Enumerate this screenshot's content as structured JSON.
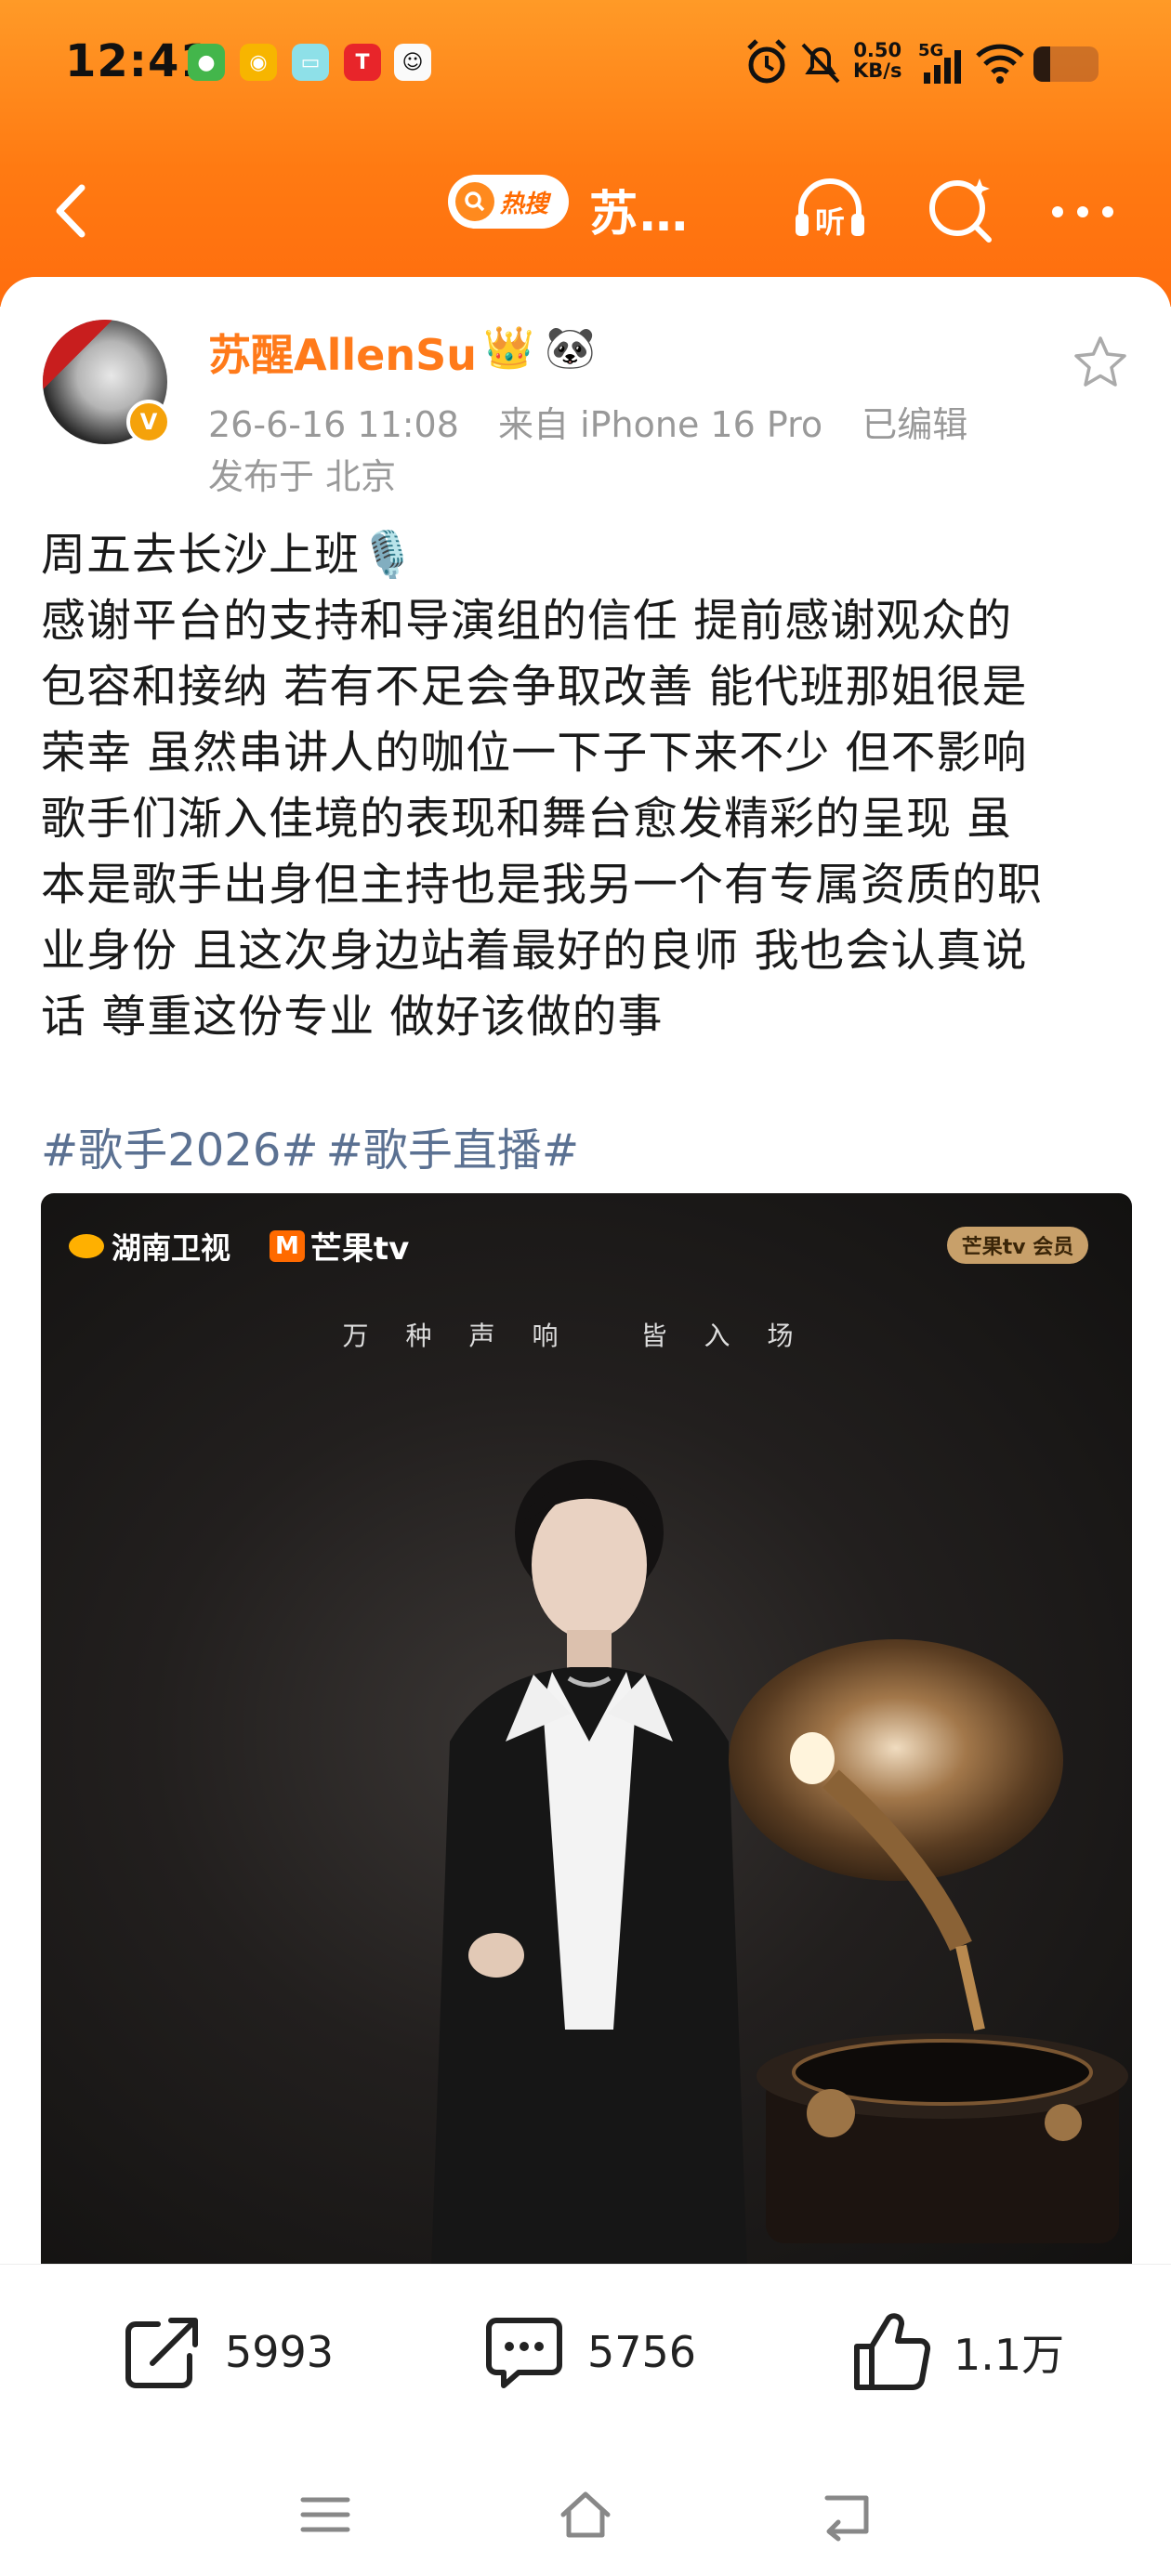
{
  "status_bar": {
    "time": "12:41",
    "net_speed_value": "0.50",
    "net_speed_unit": "KB/s",
    "network": "5G",
    "icons": [
      "app-icon-1",
      "weibo-icon",
      "app-icon-3",
      "tesla-icon",
      "qq-icon",
      "alarm-icon",
      "mute-icon",
      "signal-icon",
      "wifi-icon",
      "battery-icon"
    ]
  },
  "nav": {
    "hot_search_label": "热搜",
    "title": "苏…",
    "listen_label": "听",
    "icons": [
      "back-icon",
      "headphone-icon",
      "search-icon",
      "more-icon"
    ]
  },
  "post": {
    "author_name": "苏醒AllenSu",
    "verified_badge": "V",
    "date": "26-6-16 11:08",
    "source": "来自 iPhone 16 Pro",
    "edited": "已编辑",
    "location": "发布于 北京",
    "lines": [
      "周五去长沙上班🎙️",
      "感谢平台的支持和导演组的信任 提前感谢观众的",
      "包容和接纳 若有不足会争取改善 能代班那姐很是",
      "荣幸 虽然串讲人的咖位一下子下来不少 但不影响",
      "歌手们渐入佳境的表现和舞台愈发精彩的呈现 虽",
      "本是歌手出身但主持也是我另一个有专属资质的职",
      "业身份 且这次身边站着最好的良师 我也会认真说",
      "话 尊重这份专业 做好该做的事"
    ],
    "tags": [
      "#歌手2026#",
      "#歌手直播#"
    ],
    "image": {
      "channel_logo": "湖南卫视",
      "platform_logo": "芒果tv",
      "vip_badge": "芒果tv 会员",
      "slogan": "万种声响  皆入场"
    }
  },
  "actions": {
    "repost_count": "5993",
    "comment_count": "5756",
    "like_count": "1.1万"
  },
  "colors": {
    "header_orange": "#ff7a12",
    "username_orange": "#ff7a1a",
    "tag_blue": "#5b7192",
    "meta_gray": "#999999"
  }
}
